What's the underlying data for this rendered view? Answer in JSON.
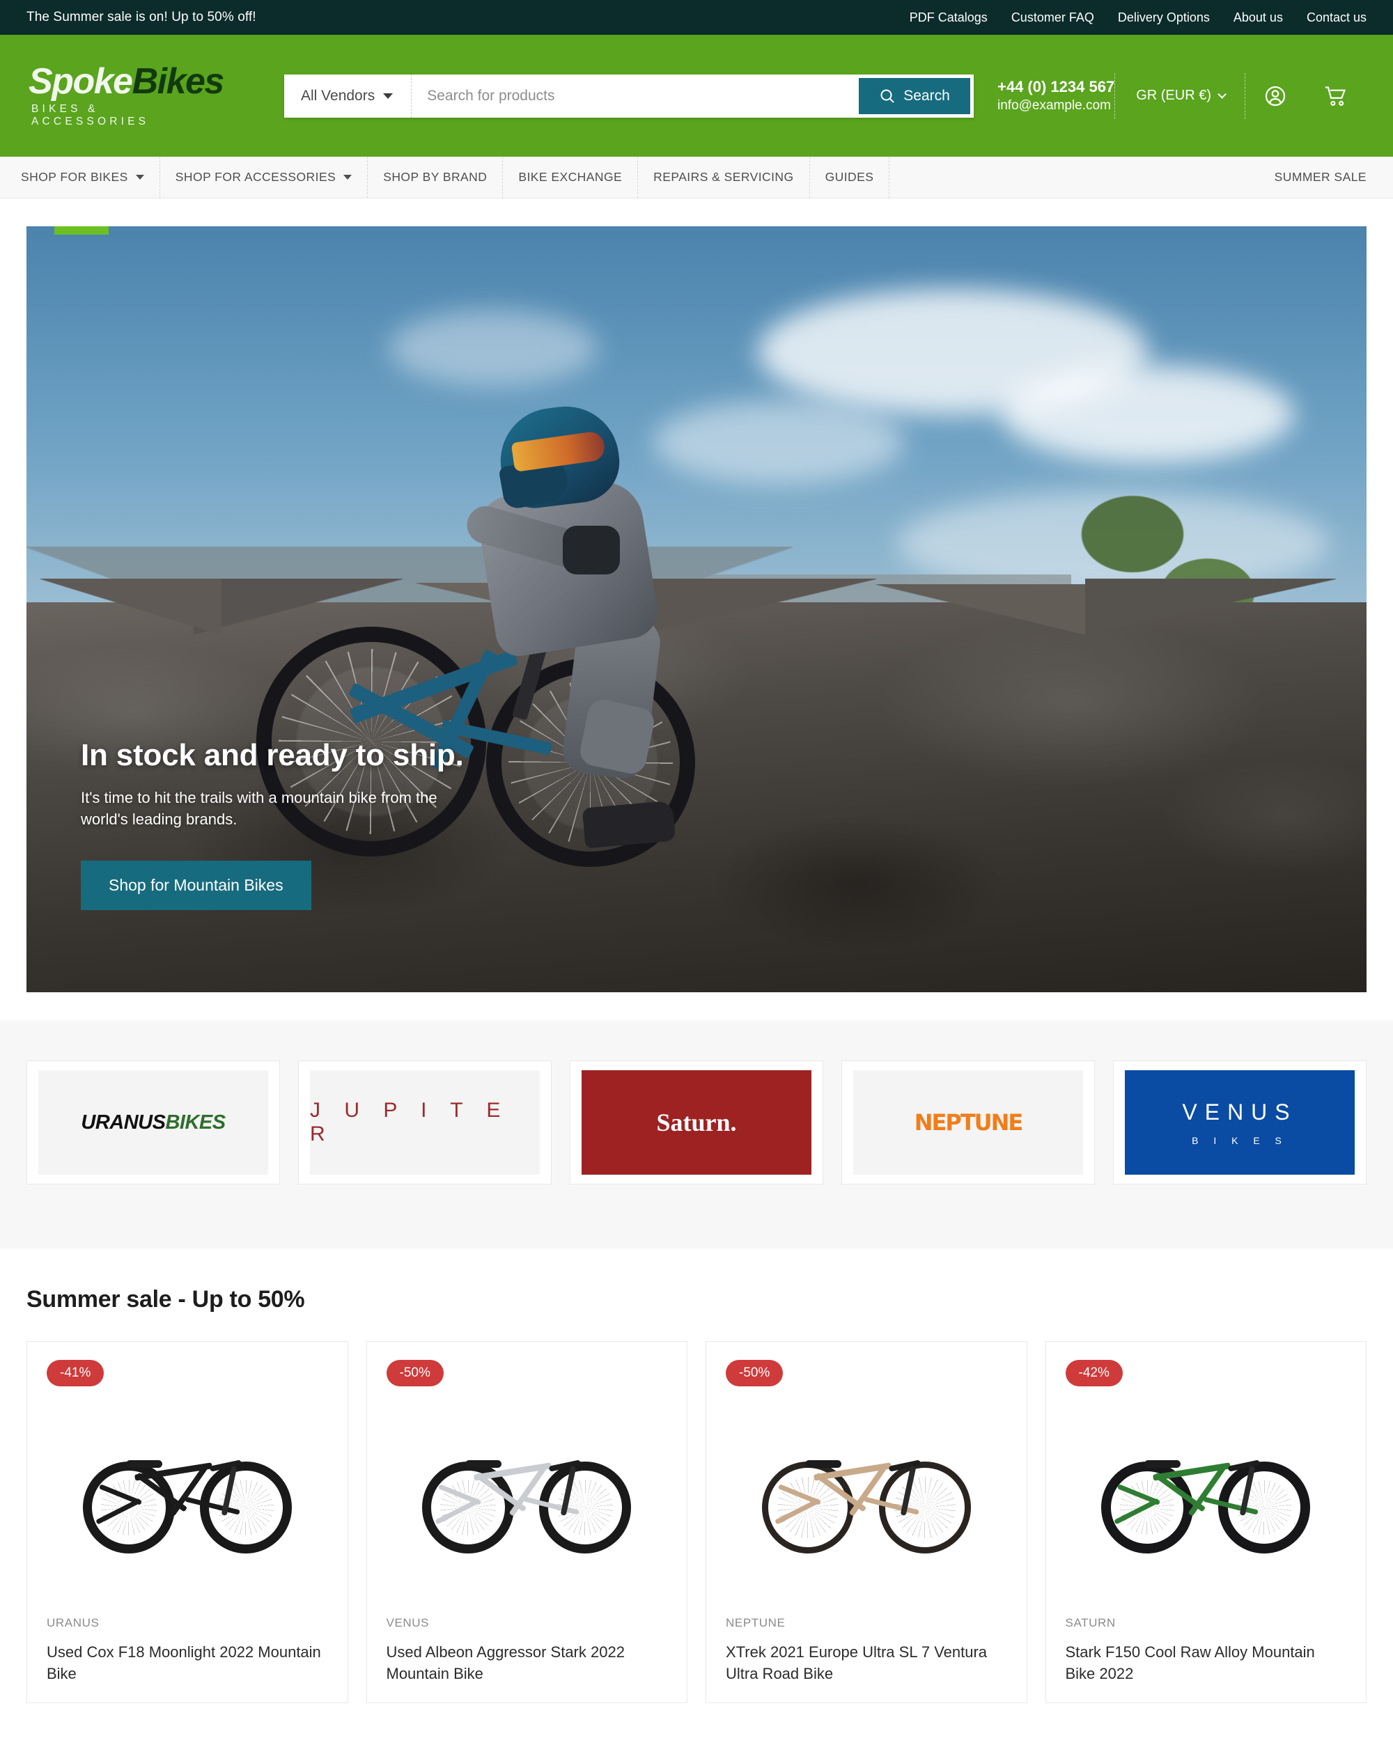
{
  "topbar": {
    "message": "The Summer sale is on! Up to 50% off!",
    "links": [
      {
        "label": "PDF Catalogs"
      },
      {
        "label": "Customer FAQ"
      },
      {
        "label": "Delivery Options"
      },
      {
        "label": "About us"
      },
      {
        "label": "Contact us"
      }
    ]
  },
  "header": {
    "logo": {
      "part1": "Spoke",
      "part2": "Bikes",
      "tagline": "BIKES & ACCESSORIES"
    },
    "search": {
      "vendor_selected": "All Vendors",
      "placeholder": "Search for products",
      "value": "",
      "button_label": "Search"
    },
    "contact": {
      "phone": "+44 (0) 1234 567",
      "email": "info@example.com"
    },
    "currency_selected": "GR (EUR €)"
  },
  "nav": {
    "items": [
      {
        "label": "SHOP FOR BIKES",
        "has_dropdown": true
      },
      {
        "label": "SHOP FOR ACCESSORIES",
        "has_dropdown": true
      },
      {
        "label": "SHOP BY BRAND",
        "has_dropdown": false
      },
      {
        "label": "BIKE EXCHANGE",
        "has_dropdown": false
      },
      {
        "label": "REPAIRS & SERVICING",
        "has_dropdown": false
      },
      {
        "label": "GUIDES",
        "has_dropdown": false
      }
    ],
    "right_label": "SUMMER SALE"
  },
  "hero": {
    "title": "In stock and ready to ship.",
    "subtitle": "It's time to hit the trails with a mountain bike from the world's leading brands.",
    "cta_label": "Shop for Mountain Bikes"
  },
  "brands": [
    {
      "name_part1": "URANUS",
      "name_part2": "BIKES",
      "style": "uranus"
    },
    {
      "name": "J U P I T E R",
      "style": "jupiter"
    },
    {
      "name": "Saturn.",
      "style": "saturn"
    },
    {
      "name": "NEPTUNE",
      "style": "neptune"
    },
    {
      "name_part1": "VENUS",
      "name_part2": "B I K E S",
      "style": "venus"
    }
  ],
  "products_section": {
    "title": "Summer sale - Up to 50%",
    "items": [
      {
        "discount": "-41%",
        "vendor": "URANUS",
        "title": "Used Cox F18 Moonlight 2022 Mountain Bike",
        "color_class": "mono-black"
      },
      {
        "discount": "-50%",
        "vendor": "VENUS",
        "title": "Used Albeon Aggressor Stark 2022 Mountain Bike",
        "color_class": "mono-silver"
      },
      {
        "discount": "-50%",
        "vendor": "NEPTUNE",
        "title": "XTrek 2021 Europe Ultra SL 7 Ventura Ultra Road Bike",
        "color_class": "mono-cream"
      },
      {
        "discount": "-42%",
        "vendor": "SATURN",
        "title": "Stark F150 Cool Raw Alloy Mountain Bike 2022",
        "color_class": "mono-green"
      }
    ]
  },
  "colors": {
    "topbar_bg": "#0c2b2b",
    "header_green": "#5aa41e",
    "accent_teal": "#176b7e",
    "badge_red": "#cf3a3a",
    "hero_accent_green": "#6cc024"
  }
}
